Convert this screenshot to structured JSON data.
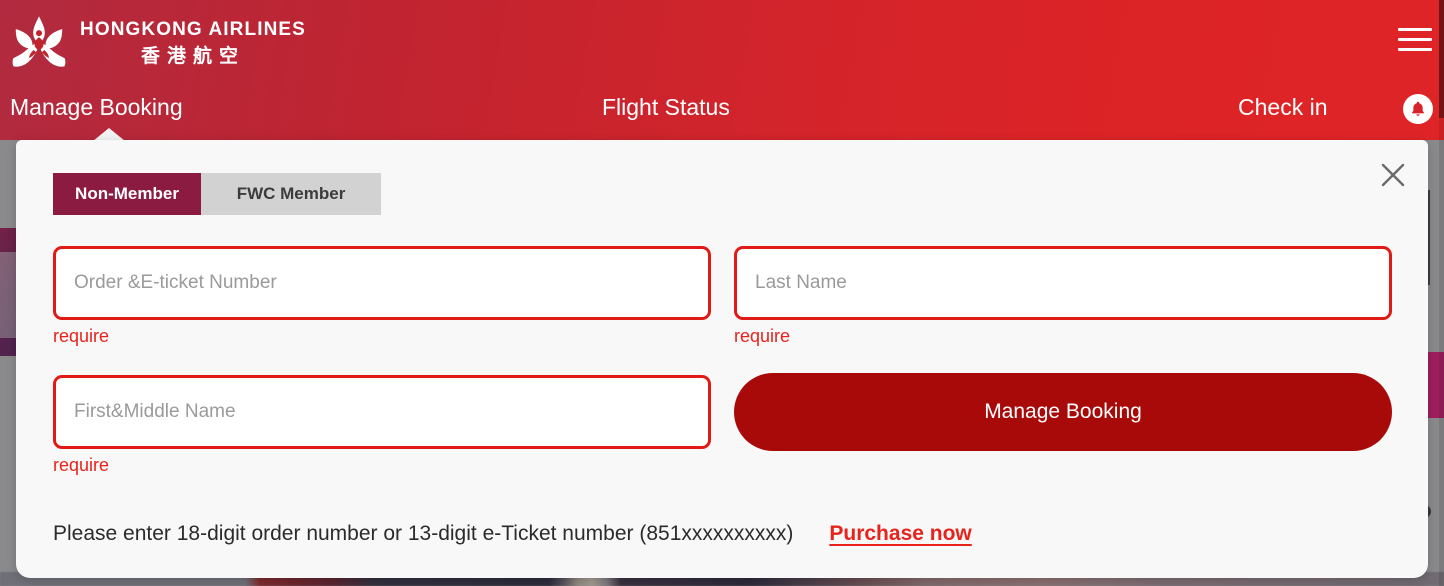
{
  "brand": {
    "name_en": "HONGKONG AIRLINES",
    "name_zh": "香港航空",
    "logo_icon": "bauhinia-logo-icon"
  },
  "header": {
    "nav": [
      {
        "label": "Manage Booking",
        "active": true
      },
      {
        "label": "Flight Status",
        "active": false
      },
      {
        "label": "Check in",
        "active": false
      }
    ],
    "menu_icon": "hamburger-menu-icon",
    "notification_icon": "bell-icon",
    "accent_color": "#d3242b",
    "accent_color_left": "#b12a3f"
  },
  "panel": {
    "close_icon": "close-x-icon",
    "tabs": [
      {
        "label": "Non-Member",
        "active": true
      },
      {
        "label": "FWC Member",
        "active": false
      }
    ],
    "active_tab_color": "#8c1b42",
    "inactive_tab_color": "#d2d2d2",
    "fields": {
      "order": {
        "placeholder": "Order &E-ticket Number",
        "value": "",
        "error": "require"
      },
      "last_name": {
        "placeholder": "Last Name",
        "value": "",
        "error": "require"
      },
      "first_middle_name": {
        "placeholder": "First&Middle Name",
        "value": "",
        "error": "require"
      }
    },
    "error_color": "#e8231c",
    "submit_label": "Manage Booking",
    "submit_color": "#a80a0a",
    "hint_text": "Please enter 18-digit order number or 13-digit e-Ticket number (851xxxxxxxxxx)",
    "purchase_link_label": "Purchase now"
  }
}
